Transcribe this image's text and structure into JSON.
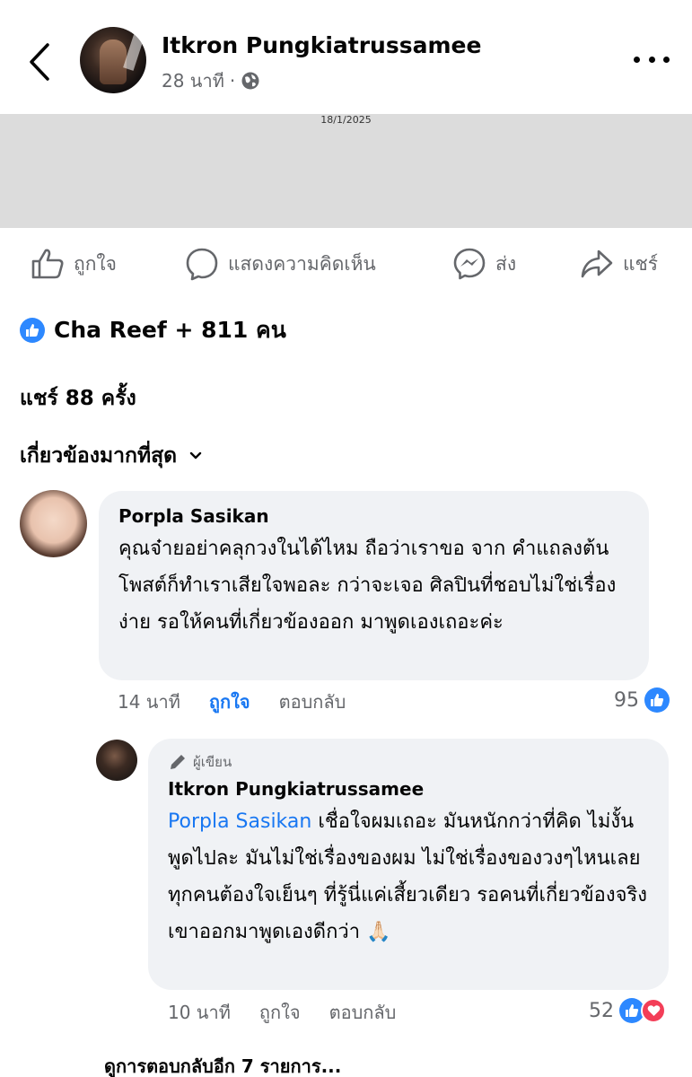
{
  "header": {
    "author": "Itkron Pungkiatrussamee",
    "time": "28 นาที",
    "separator": "·",
    "back_icon": "chevron-left-icon",
    "privacy_icon": "globe-icon",
    "more_icon": "more-horizontal-icon"
  },
  "post_image": {
    "date_text": "18/1/2025"
  },
  "actions": {
    "like": "ถูกใจ",
    "comment": "แสดงความคิดเห็น",
    "send": "ส่ง",
    "share": "แชร์"
  },
  "reactions": {
    "text": "Cha Reef + 811 คน"
  },
  "shares": {
    "text": "แชร์ 88 ครั้ง"
  },
  "sort": {
    "label": "เกี่ยวข้องมากที่สุด"
  },
  "comments": [
    {
      "name": "Porpla Sasikan",
      "text": "คุณจ๋ายอย่าคลุกวงในได้ไหม ถือว่าเราขอ จาก คำแถลงต้นโพสต์ก็ทำเราเสียใจพอละ กว่าจะเจอ ศิลปินที่ชอบไม่ใช่เรื่องง่าย รอให้คนที่เกี่ยวข้องออก มาพูดเองเถอะค่ะ",
      "time": "14 นาที",
      "like": "ถูกใจ",
      "reply": "ตอบกลับ",
      "reaction_count": "95"
    }
  ],
  "reply": {
    "badge": "ผู้เขียน",
    "name": "Itkron Pungkiatrussamee",
    "mention": "Porpla Sasikan",
    "text": " เชื่อใจผมเถอะ มันหนักกว่าที่คิด ไม่งั้นพูดไปละ มันไม่ใช่เรื่องของผม ไม่ใช่เรื่องของวงๆไหนเลย ทุกคนต้องใจเย็นๆ ที่รู้นี่แค่เสี้ยวเดียว รอคนที่เกี่ยวข้องจริงเขาออกมาพูดเองดีกว่า 🙏🏻",
    "time": "10 นาที",
    "like": "ถูกใจ",
    "reply": "ตอบกลับ",
    "reaction_count": "52"
  },
  "more_replies": "ดูการตอบกลับอีก 7 รายการ...",
  "colors": {
    "accent": "#1877f2",
    "like_badge": "#2d88ff",
    "heart_badge": "#f33e58",
    "bubble": "#f0f2f5",
    "muted": "#65676b"
  }
}
